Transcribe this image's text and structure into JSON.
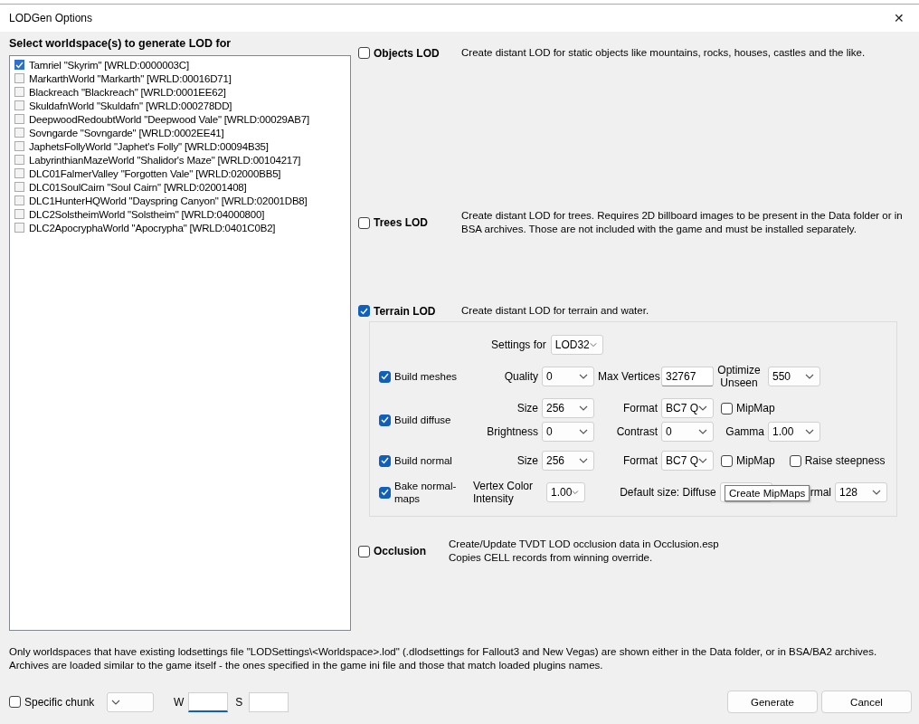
{
  "window": {
    "title": "LODGen Options",
    "close": "✕"
  },
  "worldspaces": {
    "heading": "Select worldspace(s) to generate LOD for",
    "items": [
      {
        "label": "Tamriel \"Skyrim\" [WRLD:0000003C]",
        "checked": true
      },
      {
        "label": "MarkarthWorld \"Markarth\" [WRLD:00016D71]",
        "checked": false
      },
      {
        "label": "Blackreach \"Blackreach\" [WRLD:0001EE62]",
        "checked": false
      },
      {
        "label": "SkuldafnWorld \"Skuldafn\" [WRLD:000278DD]",
        "checked": false
      },
      {
        "label": "DeepwoodRedoubtWorld \"Deepwood Vale\" [WRLD:00029AB7]",
        "checked": false
      },
      {
        "label": "Sovngarde \"Sovngarde\" [WRLD:0002EE41]",
        "checked": false
      },
      {
        "label": "JaphetsFollyWorld \"Japhet's Folly\" [WRLD:00094B35]",
        "checked": false
      },
      {
        "label": "LabyrinthianMazeWorld \"Shalidor's Maze\" [WRLD:00104217]",
        "checked": false
      },
      {
        "label": "DLC01FalmerValley \"Forgotten Vale\" [WRLD:02000BB5]",
        "checked": false
      },
      {
        "label": "DLC01SoulCairn \"Soul Cairn\" [WRLD:02001408]",
        "checked": false
      },
      {
        "label": "DLC1HunterHQWorld \"Dayspring Canyon\" [WRLD:02001DB8]",
        "checked": false
      },
      {
        "label": "DLC2SolstheimWorld \"Solstheim\" [WRLD:04000800]",
        "checked": false
      },
      {
        "label": "DLC2ApocryphaWorld \"Apocrypha\" [WRLD:0401C0B2]",
        "checked": false
      }
    ]
  },
  "sections": [
    {
      "label": "Objects LOD",
      "checked": false,
      "description": [
        "Create distant LOD for static objects like mountains, rocks, houses, castles and the like."
      ]
    },
    {
      "label": "Trees LOD",
      "checked": false,
      "description": [
        "Create distant LOD for trees. Requires 2D billboard images to be present in the Data folder or in BSA archives. Those are not included with the game and must be installed separately."
      ]
    },
    {
      "label": "Terrain LOD",
      "checked": true,
      "description": [
        "Create distant LOD for terrain and water."
      ]
    },
    {
      "label": "Occlusion",
      "checked": false,
      "description": [
        "Create/Update TVDT LOD occlusion data in Occlusion.esp",
        "Copies CELL records from winning override."
      ]
    }
  ],
  "terrain_settings": {
    "settings_for": {
      "label": "Settings for",
      "value": "LOD32"
    },
    "rows": [
      {
        "kind": "grid",
        "label": "Build meshes",
        "checked": true,
        "lines": [
          [
            {
              "kind": "combo",
              "label": "Quality",
              "value": "0"
            },
            {
              "kind": "field",
              "label": "Max Vertices",
              "value": "32767"
            },
            {
              "kind": "combo",
              "label": "Optimize Unseen",
              "value": "550"
            }
          ]
        ]
      },
      {
        "kind": "grid",
        "label": "Build diffuse",
        "checked": true,
        "lines": [
          [
            {
              "kind": "combo",
              "label": "Size",
              "value": "256"
            },
            {
              "kind": "combo",
              "label": "Format",
              "value": "BC7 Q"
            },
            {
              "kind": "check",
              "label": "MipMap",
              "checked": false
            }
          ],
          [
            {
              "kind": "combo",
              "label": "Brightness",
              "value": "0"
            },
            {
              "kind": "combo",
              "label": "Contrast",
              "value": "0"
            },
            {
              "kind": "combo",
              "label": "Gamma",
              "value": "1.00"
            }
          ]
        ]
      },
      {
        "kind": "grid",
        "label": "Build normal",
        "checked": true,
        "lines": [
          [
            {
              "kind": "combo",
              "label": "Size",
              "value": "256"
            },
            {
              "kind": "combo",
              "label": "Format",
              "value": "BC7 Q"
            },
            {
              "kind": "check",
              "label": "MipMap",
              "checked": false
            },
            {
              "kind": "check",
              "label": "Raise steepness",
              "checked": false
            }
          ]
        ]
      },
      {
        "kind": "free",
        "label": "Bake normal-maps",
        "checked": true,
        "lines": [
          [
            {
              "kind": "combo",
              "label": "Vertex Color Intensity",
              "value": "1.00"
            },
            {
              "kind": "combo",
              "label": "Default size: Diffuse"
            },
            {
              "kind": "combo",
              "label": "rmal",
              "value": "128"
            }
          ]
        ]
      }
    ],
    "tooltip": "Create MipMaps"
  },
  "note": [
    "Only worldspaces that have existing lodsettings file \"LODSettings\\<Worldspace>.lod\" (.dlodsettings for Fallout3 and New Vegas) are shown either in the Data folder, or in BSA/BA2 archives.",
    "Archives are loaded similar to the game itself - the ones specified in the game ini file and those that match loaded plugins names."
  ],
  "bottom": {
    "specific_chunk": {
      "label": "Specific chunk",
      "checked": false
    },
    "w_label": "W",
    "s_label": "S",
    "buttons": [
      "Generate",
      "Cancel"
    ]
  }
}
